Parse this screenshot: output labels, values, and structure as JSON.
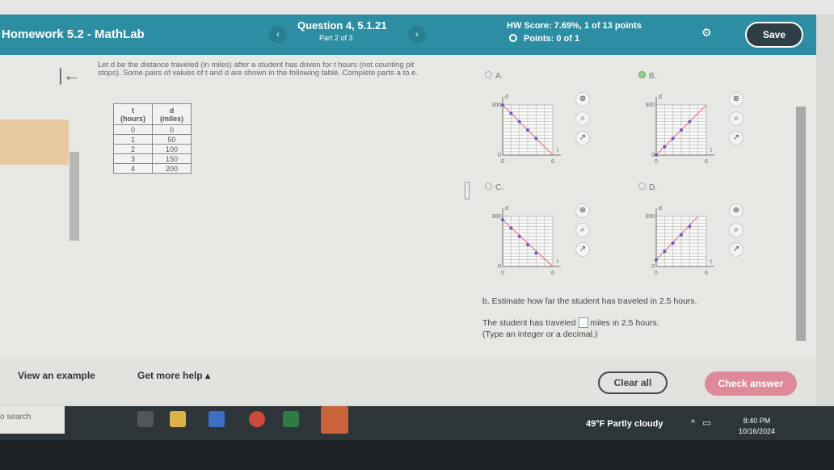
{
  "header": {
    "title": "Homework 5.2 - MathLab",
    "prev": "‹",
    "next": "›",
    "question": "Question 4, 5.1.21",
    "part": "Part 2 of 3",
    "score": "HW Score: 7.69%, 1 of 13 points",
    "points": "Points: 0 of 1",
    "save": "Save"
  },
  "problem": {
    "prompt": "Let d be the distance traveled (in miles) after a student has driven for t hours (not counting pit stops). Some pairs of values of t and d are shown in the following table. Complete parts a to e.",
    "table": {
      "headers": [
        [
          "t",
          "(hours)"
        ],
        [
          "d",
          "(miles)"
        ]
      ],
      "rows": [
        [
          "0",
          "0"
        ],
        [
          "1",
          "50"
        ],
        [
          "2",
          "100"
        ],
        [
          "3",
          "150"
        ],
        [
          "4",
          "200"
        ]
      ]
    }
  },
  "options": [
    {
      "label": "A.",
      "selected": false,
      "y_top": "300",
      "y_zero": "0",
      "x_zero": "0",
      "x_end": "6",
      "line": [
        [
          0,
          300
        ],
        [
          6,
          0
        ]
      ],
      "points": [
        [
          0,
          300
        ],
        [
          1,
          250
        ],
        [
          2,
          200
        ],
        [
          3,
          150
        ],
        [
          4,
          100
        ]
      ]
    },
    {
      "label": "B.",
      "selected": true,
      "y_top": "300",
      "y_zero": "0",
      "x_zero": "0",
      "x_end": "6",
      "line": [
        [
          0,
          0
        ],
        [
          6,
          300
        ]
      ],
      "points": [
        [
          0,
          0
        ],
        [
          1,
          50
        ],
        [
          2,
          100
        ],
        [
          3,
          150
        ],
        [
          4,
          200
        ]
      ]
    },
    {
      "label": "C.",
      "selected": false,
      "y_top": "300",
      "y_zero": "0",
      "x_zero": "0",
      "x_end": "6",
      "line": [
        [
          0,
          280
        ],
        [
          6,
          0
        ]
      ],
      "points": [
        [
          0,
          280
        ],
        [
          1,
          230
        ],
        [
          2,
          180
        ],
        [
          3,
          130
        ],
        [
          4,
          80
        ]
      ]
    },
    {
      "label": "D.",
      "selected": false,
      "y_top": "300",
      "y_zero": "0",
      "x_zero": "0",
      "x_end": "6",
      "line": [
        [
          0,
          40
        ],
        [
          5,
          300
        ]
      ],
      "points": [
        [
          0,
          40
        ],
        [
          1,
          90
        ],
        [
          2,
          140
        ],
        [
          3,
          190
        ],
        [
          4,
          240
        ]
      ]
    }
  ],
  "graph_axes": {
    "x": "t",
    "y": "d",
    "xlim": [
      0,
      6
    ],
    "ylim": [
      0,
      300
    ]
  },
  "part_b": {
    "question": "b. Estimate how far the student has traveled in 2.5 hours.",
    "before": "The student has traveled",
    "after": "miles in 2.5 hours.",
    "answer": "",
    "hint": "(Type an integer or a decimal.)"
  },
  "footer": {
    "example": "View an example",
    "help": "Get more help ▴",
    "clear": "Clear all",
    "check": "Check answer"
  },
  "taskbar": {
    "search": "o search",
    "weather": "49°F  Partly cloudy",
    "time": "8:40 PM",
    "date": "10/16/2024"
  },
  "colors": {
    "header": "#2d8ea3",
    "check": "#de8a99",
    "line": "#e07a8a",
    "point": "#6a5acd"
  }
}
